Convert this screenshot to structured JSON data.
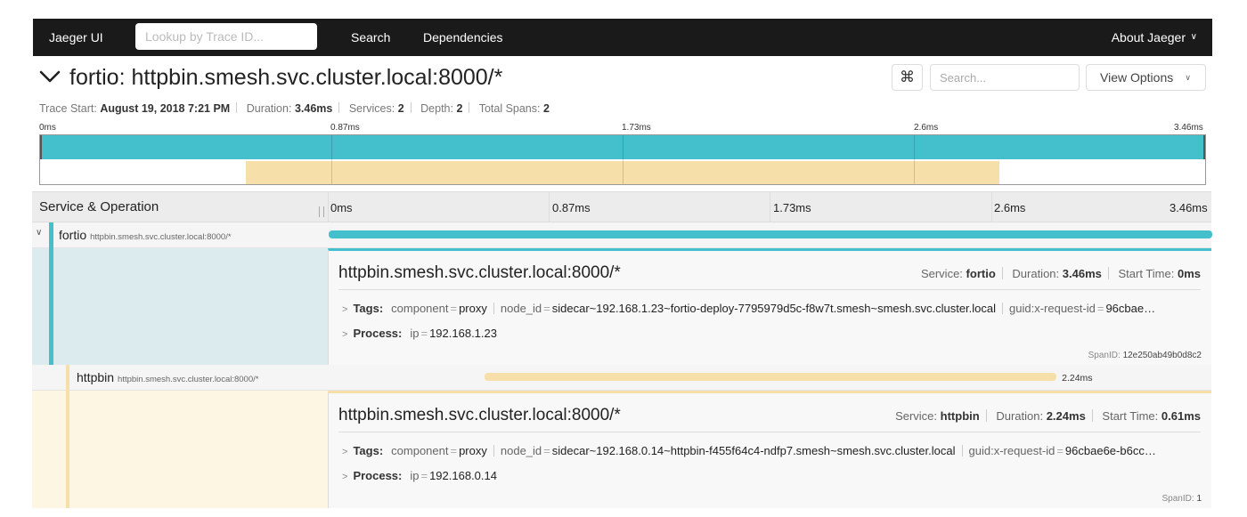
{
  "nav": {
    "brand": "Jaeger UI",
    "lookup_placeholder": "Lookup by Trace ID...",
    "search": "Search",
    "dependencies": "Dependencies",
    "about": "About Jaeger"
  },
  "trace": {
    "title": "fortio: httpbin.smesh.svc.cluster.local:8000/*",
    "cmd_icon": "⌘",
    "search_placeholder": "Search...",
    "view_options": "View Options",
    "meta": {
      "trace_start_label": "Trace Start:",
      "trace_start": "August 19, 2018 7:21 PM",
      "duration_label": "Duration:",
      "duration": "3.46ms",
      "services_label": "Services:",
      "services": "2",
      "depth_label": "Depth:",
      "depth": "2",
      "total_spans_label": "Total Spans:",
      "total_spans": "2"
    }
  },
  "ticks": [
    "0ms",
    "0.87ms",
    "1.73ms",
    "2.6ms",
    "3.46ms"
  ],
  "timeline": {
    "header_label": "Service & Operation"
  },
  "colors": {
    "fortio": "#44bfcc",
    "httpbin": "#f7dfa9"
  },
  "spans": [
    {
      "service": "fortio",
      "operation": "httpbin.smesh.svc.cluster.local:8000/*",
      "start_ms": 0,
      "duration_ms": 3.46,
      "detail": {
        "title": "httpbin.smesh.svc.cluster.local:8000/*",
        "service_label": "Service:",
        "service": "fortio",
        "duration_label": "Duration:",
        "duration": "3.46ms",
        "start_label": "Start Time:",
        "start": "0ms",
        "tags_label": "Tags:",
        "tags": [
          {
            "key": "component",
            "value": "proxy"
          },
          {
            "key": "node_id",
            "value": "sidecar~192.168.1.23~fortio-deploy-7795979d5c-f8w7t.smesh~smesh.svc.cluster.local"
          },
          {
            "key": "guid:x-request-id",
            "value": "96cbae…"
          }
        ],
        "process_label": "Process:",
        "process": [
          {
            "key": "ip",
            "value": "192.168.1.23"
          }
        ],
        "spanid_label": "SpanID:",
        "spanid": "12e250ab49b0d8c2"
      }
    },
    {
      "service": "httpbin",
      "operation": "httpbin.smesh.svc.cluster.local:8000/*",
      "start_ms": 0.61,
      "duration_ms": 2.24,
      "bar_label": "2.24ms",
      "detail": {
        "title": "httpbin.smesh.svc.cluster.local:8000/*",
        "service_label": "Service:",
        "service": "httpbin",
        "duration_label": "Duration:",
        "duration": "2.24ms",
        "start_label": "Start Time:",
        "start": "0.61ms",
        "tags_label": "Tags:",
        "tags": [
          {
            "key": "component",
            "value": "proxy"
          },
          {
            "key": "node_id",
            "value": "sidecar~192.168.0.14~httpbin-f455f64c4-ndfp7.smesh~smesh.svc.cluster.local"
          },
          {
            "key": "guid:x-request-id",
            "value": "96cbae6e-b6cc…"
          }
        ],
        "process_label": "Process:",
        "process": [
          {
            "key": "ip",
            "value": "192.168.0.14"
          }
        ],
        "spanid_label": "SpanID:",
        "spanid": "1"
      }
    }
  ]
}
